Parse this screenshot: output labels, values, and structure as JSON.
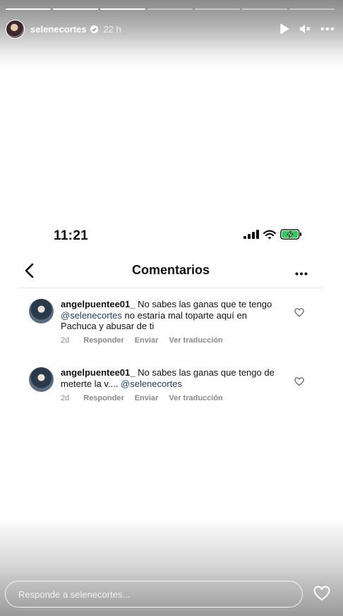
{
  "story": {
    "segments_total": 7,
    "segments_done": 3,
    "username": "selenecortes",
    "time_ago": "22 h",
    "reply_placeholder": "Responde a selenecortes..."
  },
  "screenshot": {
    "clock": "11:21",
    "nav_title": "Comentarios",
    "comments": [
      {
        "user": "angelpuentee01_",
        "text_before": " No sabes las ganas que te tengo ",
        "mention": "@selenecortes",
        "text_after": "  no estaría mal toparte aquí en Pachuca y abusar de ti",
        "age": "2d",
        "reply": "Responder",
        "send": "Enviar",
        "translate": "Ver traducción"
      },
      {
        "user": "angelpuentee01_",
        "text_before": " No sabes las ganas que tengo de meterte la v.... ",
        "mention": "@selenecortes",
        "text_after": "",
        "age": "2d",
        "reply": "Responder",
        "send": "Enviar",
        "translate": "Ver traducción"
      }
    ]
  },
  "colors": {
    "mention": "#1e3f66",
    "battery": "#34c759"
  },
  "icons": [
    "play-icon",
    "mute-icon",
    "more-icon",
    "verified-icon",
    "back-chevron-icon",
    "signal-icon",
    "wifi-icon",
    "battery-icon",
    "heart-icon"
  ]
}
